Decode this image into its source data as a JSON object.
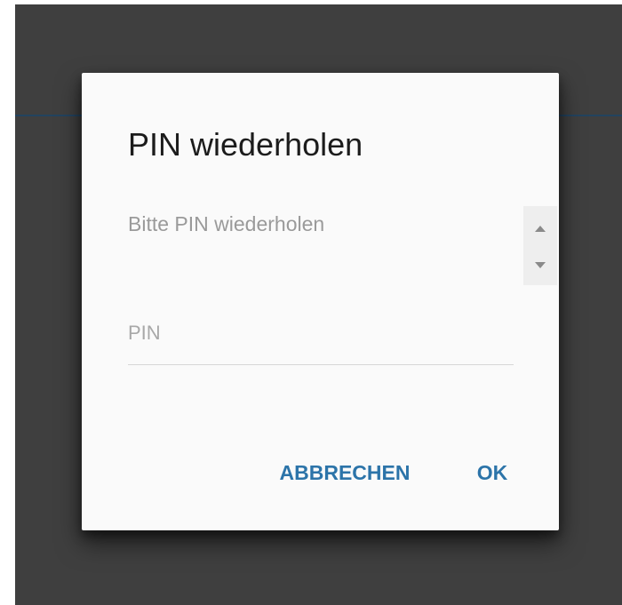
{
  "dialog": {
    "title": "PIN wiederholen",
    "message": "Bitte PIN wiederholen",
    "pin_placeholder": "PIN",
    "pin_value": "",
    "cancel_label": "ABBRECHEN",
    "ok_label": "OK"
  },
  "colors": {
    "backdrop": "#3f3f3f",
    "accent": "#2c74a9",
    "dialog_background": "#fafafa"
  },
  "icons": {
    "scroll_up": "triangle-up-icon",
    "scroll_down": "triangle-down-icon"
  }
}
